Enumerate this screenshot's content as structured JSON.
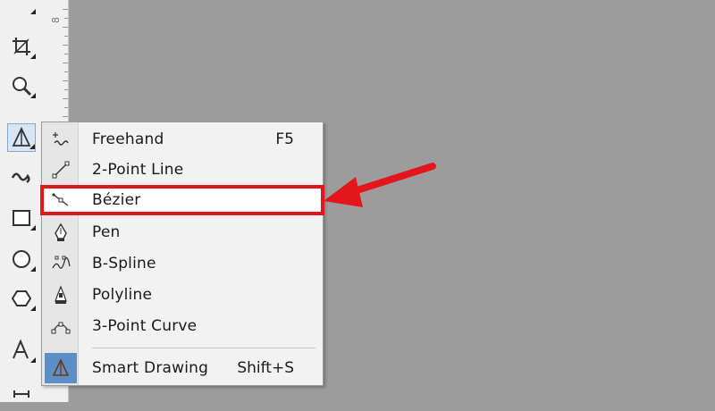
{
  "menu": {
    "items": [
      {
        "label": "Freehand",
        "shortcut": "F5",
        "icon": "freehand-icon"
      },
      {
        "label": "2-Point Line",
        "shortcut": "",
        "icon": "two-point-line-icon"
      },
      {
        "label": "Bézier",
        "shortcut": "",
        "icon": "bezier-icon"
      },
      {
        "label": "Pen",
        "shortcut": "",
        "icon": "pen-icon"
      },
      {
        "label": "B-Spline",
        "shortcut": "",
        "icon": "b-spline-icon"
      },
      {
        "label": "Polyline",
        "shortcut": "",
        "icon": "polyline-icon"
      },
      {
        "label": "3-Point Curve",
        "shortcut": "",
        "icon": "three-point-curve-icon"
      },
      {
        "label": "Smart Drawing",
        "shortcut": "Shift+S",
        "icon": "smart-drawing-icon"
      }
    ]
  },
  "ruler": {
    "label": "8"
  },
  "toolbox": {
    "tools": [
      "shape-tool-icon",
      "crop-tool-icon",
      "zoom-tool-icon",
      "curve-tool-icon",
      "artistic-media-icon",
      "rectangle-tool-icon",
      "ellipse-tool-icon",
      "polygon-tool-icon",
      "text-tool-icon",
      "dimension-tool-icon"
    ]
  },
  "colors": {
    "canvas": "#9c9c9c",
    "highlight": "#e2161b",
    "arrow": "#e2161b",
    "active_icon_bg": "#5b8fc5"
  }
}
